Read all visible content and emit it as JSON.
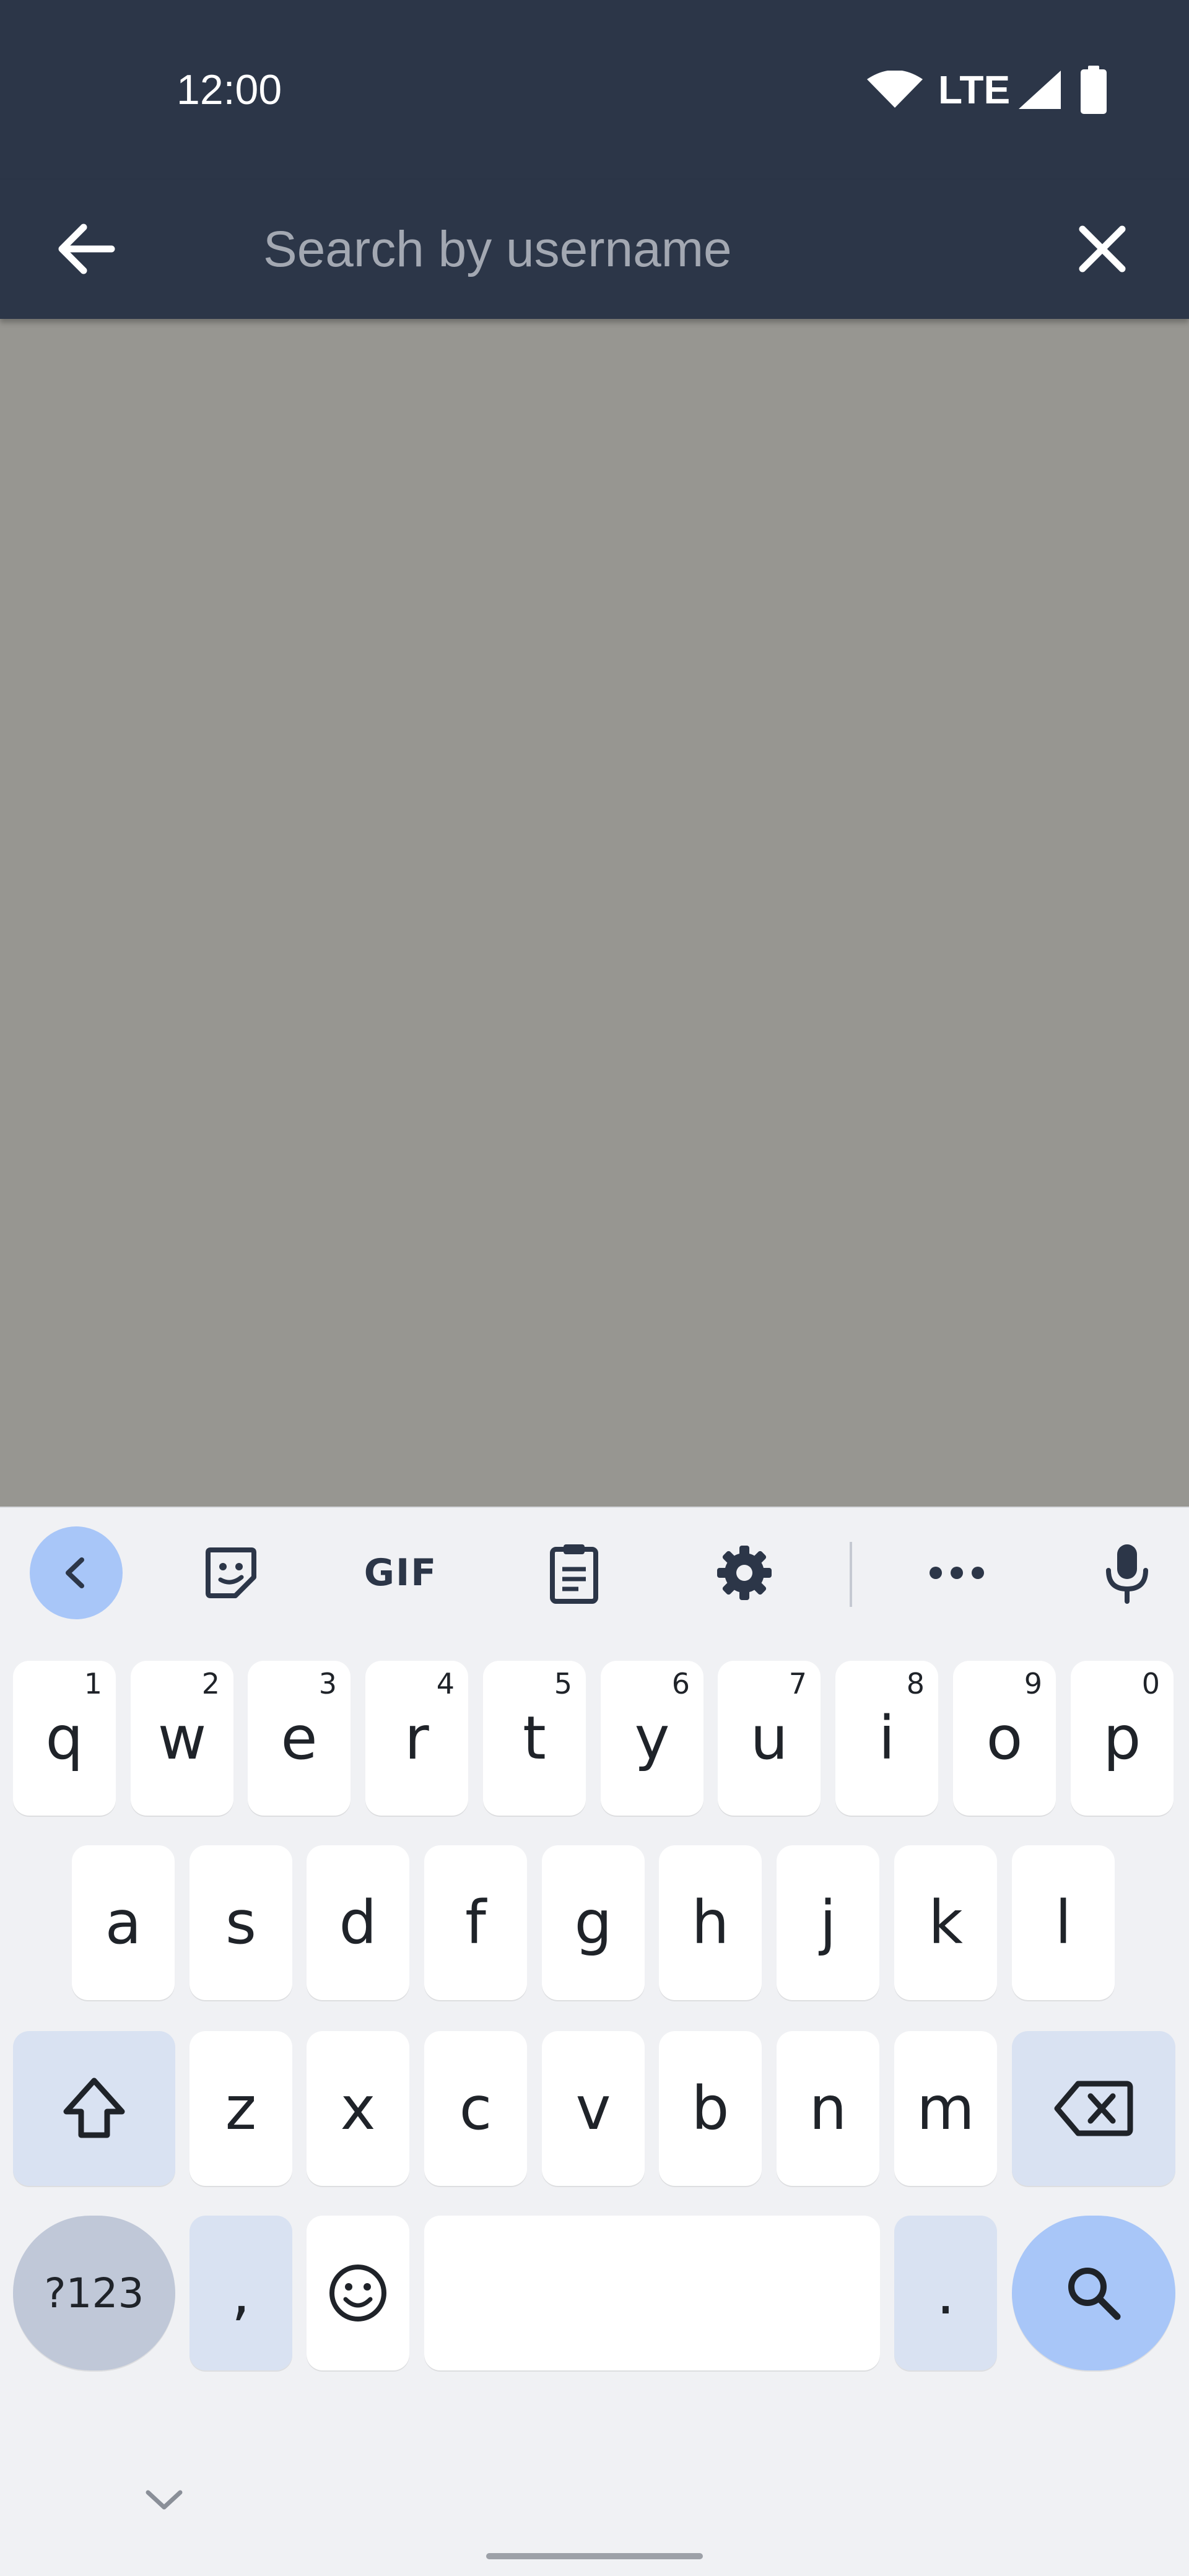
{
  "status_bar": {
    "time": "12:00",
    "network": "LTE",
    "icons": [
      "wifi-icon",
      "cell-signal-icon",
      "battery-icon"
    ]
  },
  "search_bar": {
    "placeholder": "Search by username",
    "value": "",
    "back_icon": "arrow-back-icon",
    "clear_icon": "close-icon"
  },
  "keyboard": {
    "toolbar": {
      "items": [
        "chevron-left-icon",
        "sticker-icon",
        "GIF",
        "clipboard-icon",
        "gear-icon",
        "more-icon",
        "mic-icon"
      ],
      "gif_label": "GIF"
    },
    "row1": [
      {
        "key": "q",
        "hint": "1"
      },
      {
        "key": "w",
        "hint": "2"
      },
      {
        "key": "e",
        "hint": "3"
      },
      {
        "key": "r",
        "hint": "4"
      },
      {
        "key": "t",
        "hint": "5"
      },
      {
        "key": "y",
        "hint": "6"
      },
      {
        "key": "u",
        "hint": "7"
      },
      {
        "key": "i",
        "hint": "8"
      },
      {
        "key": "o",
        "hint": "9"
      },
      {
        "key": "p",
        "hint": "0"
      }
    ],
    "row2": [
      "a",
      "s",
      "d",
      "f",
      "g",
      "h",
      "j",
      "k",
      "l"
    ],
    "row3": [
      "z",
      "x",
      "c",
      "v",
      "b",
      "n",
      "m"
    ],
    "row4": {
      "symbols": "?123",
      "comma": ",",
      "period": ".",
      "emoji_icon": "emoji-icon",
      "search_icon": "search-icon"
    },
    "accent_color": "#a8c6f8"
  },
  "colors": {
    "app_bar": "#2c3648",
    "scrim": "#979691",
    "keyboard_bg": "#f0f1f4"
  }
}
